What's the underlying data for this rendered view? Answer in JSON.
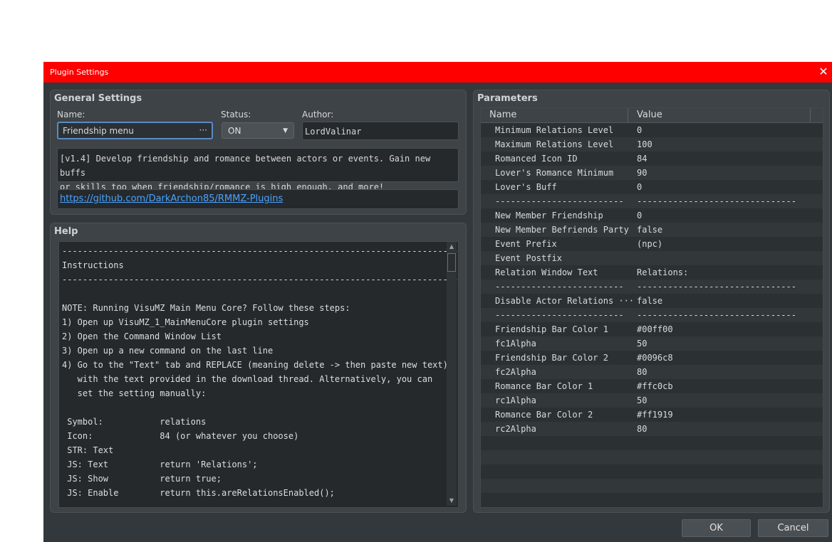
{
  "dialog": {
    "title": "Plugin Settings",
    "close_glyph": "✕"
  },
  "general": {
    "title": "General Settings",
    "name_label": "Name:",
    "name_value": "Friendship menu",
    "name_button": "···",
    "status_label": "Status:",
    "status_value": "ON",
    "author_label": "Author:",
    "author_value": "LordValinar",
    "description_lines": [
      "[v1.4] Develop friendship and romance between actors or events. Gain new buffs",
      "or skills too when friendship/romance is high enough, and more!"
    ],
    "url": "https://github.com/DarkArchon85/RMMZ-Plugins"
  },
  "help": {
    "title": "Help",
    "lines": [
      "----------------------------------------------------------------------------------",
      "Instructions",
      "----------------------------------------------------------------------------------",
      "",
      "NOTE: Running VisuMZ Main Menu Core? Follow these steps:",
      "1) Open up VisuMZ_1_MainMenuCore plugin settings",
      "2) Open the Command Window List",
      "3) Open up a new command on the last line",
      "4) Go to the \"Text\" tab and REPLACE (meaning delete -> then paste new text)",
      "   with the text provided in the download thread. Alternatively, you can",
      "   set the setting manually:",
      "",
      " Symbol:           relations",
      " Icon:             84 (or whatever you choose)",
      " STR: Text",
      " JS: Text          return 'Relations';",
      " JS: Show          return true;",
      " JS: Enable        return this.areRelationsEnabled();"
    ]
  },
  "parameters": {
    "title": "Parameters",
    "col_name": "Name",
    "col_value": "Value",
    "rows": [
      {
        "name": "Minimum Relations Level",
        "value": "0"
      },
      {
        "name": "Maximum Relations Level",
        "value": "100"
      },
      {
        "name": "Romanced Icon ID",
        "value": "84"
      },
      {
        "name": "Lover's Romance Minimum",
        "value": "90"
      },
      {
        "name": "Lover's Buff",
        "value": "0"
      },
      {
        "name": "-------------------------",
        "value": "-------------------------------"
      },
      {
        "name": "New Member Friendship",
        "value": "0"
      },
      {
        "name": "New Member Befriends Party",
        "value": "false"
      },
      {
        "name": "Event Prefix",
        "value": "(npc)"
      },
      {
        "name": "Event Postfix",
        "value": ""
      },
      {
        "name": "Relation Window Text",
        "value": "Relations:"
      },
      {
        "name": "-------------------------",
        "value": "-------------------------------"
      },
      {
        "name": "Disable Actor Relations ···",
        "value": "false"
      },
      {
        "name": "-------------------------",
        "value": "-------------------------------"
      },
      {
        "name": "Friendship Bar Color 1",
        "value": "#00ff00"
      },
      {
        "name": "fc1Alpha",
        "value": "50"
      },
      {
        "name": "Friendship Bar Color 2",
        "value": "#0096c8"
      },
      {
        "name": "fc2Alpha",
        "value": "80"
      },
      {
        "name": "Romance Bar Color 1",
        "value": "#ffc0cb"
      },
      {
        "name": "rc1Alpha",
        "value": "50"
      },
      {
        "name": "Romance Bar Color 2",
        "value": "#ff1919"
      },
      {
        "name": "rc2Alpha",
        "value": "80"
      },
      {
        "name": "",
        "value": ""
      },
      {
        "name": "",
        "value": ""
      },
      {
        "name": "",
        "value": ""
      },
      {
        "name": "",
        "value": ""
      },
      {
        "name": "",
        "value": ""
      }
    ]
  },
  "buttons": {
    "ok": "OK",
    "cancel": "Cancel"
  },
  "colors": {
    "titlebar": "#ff0000",
    "link": "#4aa3ff",
    "background": "#33383c"
  }
}
